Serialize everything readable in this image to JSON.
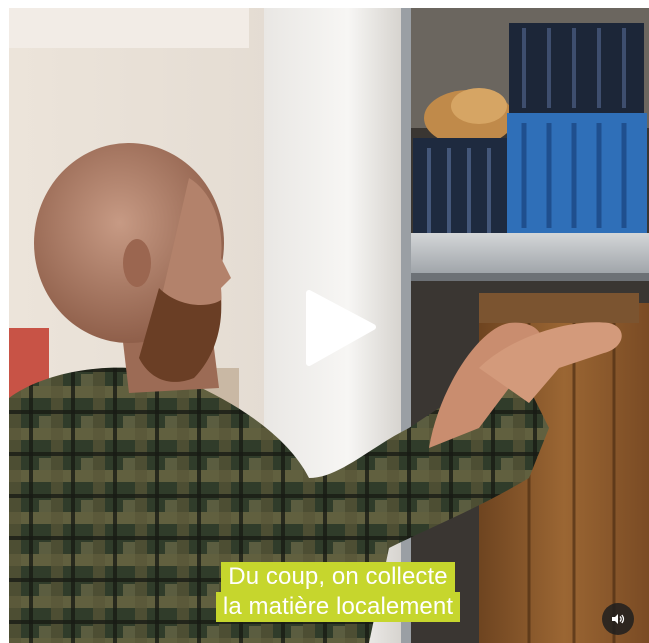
{
  "video": {
    "caption_lines": [
      "Du coup, on collecte",
      "la matière localement"
    ],
    "play_icon": "play-icon",
    "mute_icon": "speaker-icon",
    "accent_color": "#c6d62d"
  }
}
